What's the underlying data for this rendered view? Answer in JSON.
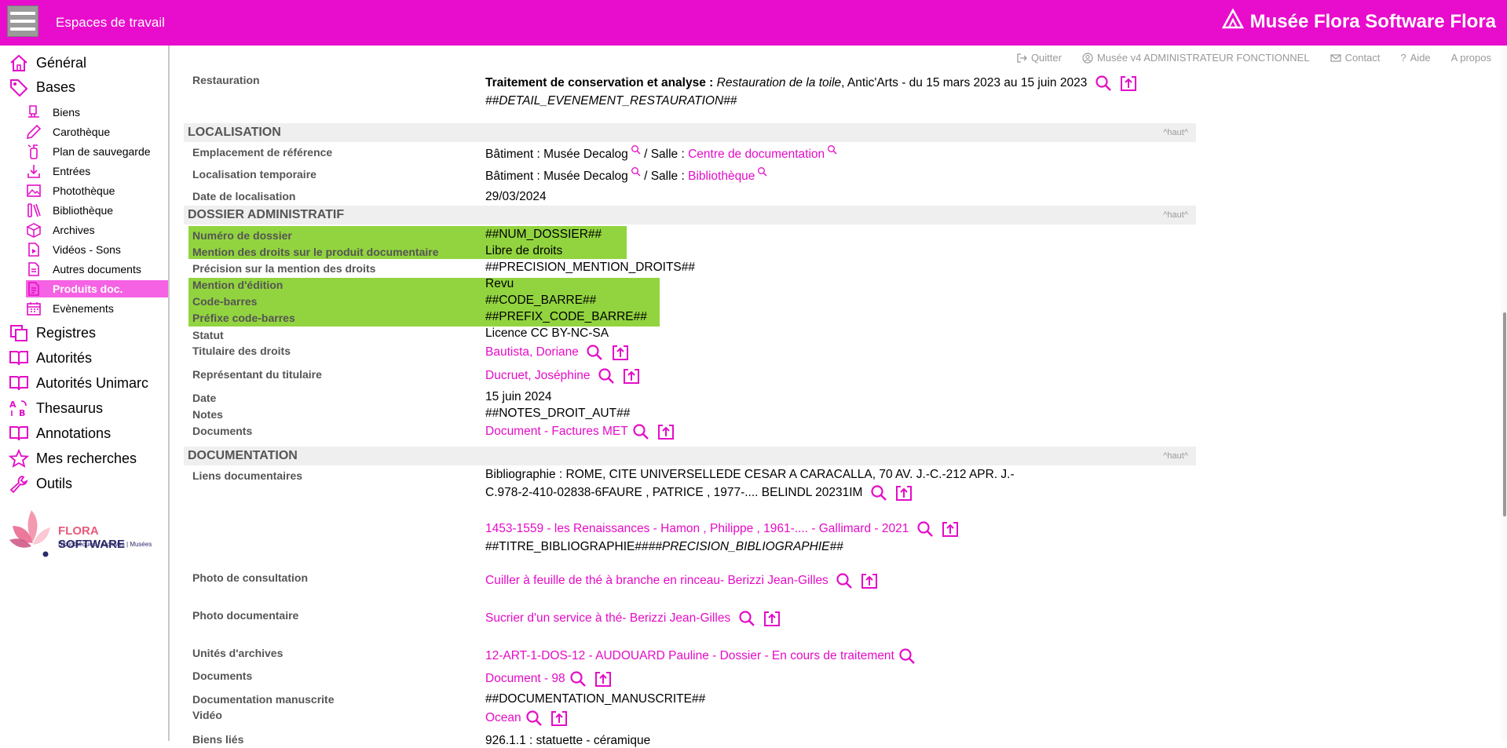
{
  "header": {
    "workspaces_label": "Espaces de travail",
    "brand": "Musée Flora Software Flora",
    "accent_color": "#e80ccc"
  },
  "utilbar": {
    "quit": "Quitter",
    "user": "Musée v4 ADMINISTRATEUR FONCTIONNEL",
    "contact": "Contact",
    "help": "Aide",
    "about": "A propos"
  },
  "sidebar": {
    "general": "Général",
    "bases": "Bases",
    "sub": [
      "Biens",
      "Carothèque",
      "Plan de sauvegarde",
      "Entrées",
      "Photothèque",
      "Bibliothèque",
      "Archives",
      "Vidéos - Sons",
      "Autres documents",
      "Produits doc.",
      "Evènements"
    ],
    "bottom": [
      "Registres",
      "Autorités",
      "Autorités Unimarc",
      "Thesaurus",
      "Annotations",
      "Mes recherches",
      "Outils"
    ],
    "logo_name_1": "FLORA",
    "logo_name_2": "SOFTWARE",
    "logo_tagline": "Bibliothèques | Archives | Musées"
  },
  "top_link": "^haut^",
  "restauration": {
    "label": "Restauration",
    "bold": "Traitement de conservation et analyse :",
    "italic": "Restauration de la toile",
    "rest": ",  Antic'Arts - du 15 mars 2023 au 15 juin 2023",
    "detail": "##DETAIL_EVENEMENT_RESTAURATION##"
  },
  "localisation": {
    "title": "LOCALISATION",
    "ref_label": "Emplacement de référence",
    "ref_building": "Bâtiment : Musée Decalog",
    "ref_sep": " /  Salle : ",
    "ref_room": "Centre de documentation",
    "temp_label": "Localisation temporaire",
    "temp_building": "Bâtiment : Musée Decalog",
    "temp_sep": " /  Salle : ",
    "temp_room": "Bibliothèque",
    "date_label": "Date de localisation",
    "date_value": "29/03/2024"
  },
  "dossier": {
    "title": "DOSSIER ADMINISTRATIF",
    "rows": [
      {
        "label": "Numéro de dossier",
        "value": "##NUM_DOSSIER##"
      },
      {
        "label": "Mention des droits sur le produit documentaire",
        "value": "Libre de droits"
      },
      {
        "label": "Précision sur la mention des droits",
        "value": "##PRECISION_MENTION_DROITS##"
      },
      {
        "label": "Mention d'édition",
        "value": "Revu"
      },
      {
        "label": "Code-barres",
        "value": "##CODE_BARRE##"
      },
      {
        "label": "Préfixe code-barres",
        "value": "##PREFIX_CODE_BARRE##"
      },
      {
        "label": "Statut",
        "value": "Licence CC BY-NC-SA"
      },
      {
        "label": "Titulaire des droits",
        "value": "Bautista, Doriane"
      },
      {
        "label": "Représentant du titulaire",
        "value": "Ducruet, Joséphine"
      },
      {
        "label": "Date",
        "value": "15 juin 2024"
      },
      {
        "label": "Notes",
        "value": "##NOTES_DROIT_AUT##"
      },
      {
        "label": "Documents",
        "value": "Document - Factures MET"
      }
    ],
    "highlight_color": "#92d43f"
  },
  "documentation": {
    "title": "DOCUMENTATION",
    "liens_label": "Liens documentaires",
    "liens_line1": "Bibliographie : ROME, CITE UNIVERSELLEDE CESAR A CARACALLA, 70 AV. J.-C.-212 APR. J.-",
    "liens_line2": "C.978-2-410-02838-6FAURE , PATRICE , 1977-.... BELINDL 20231IM",
    "liens_link": "1453-1559 - les Renaissances - Hamon , Philippe , 1961-.... - Gallimard - 2021",
    "liens_titre": "##TITRE_BIBLIOGRAPHIE##",
    "liens_precision": "##PRECISION_BIBLIOGRAPHIE##",
    "photo_consult_label": "Photo de consultation",
    "photo_consult_value": "Cuiller à feuille de thé à branche en rinceau- Berizzi Jean-Gilles",
    "photo_doc_label": "Photo documentaire",
    "photo_doc_value": "Sucrier d'un service à thé- Berizzi Jean-Gilles",
    "archives_label": "Unités d'archives",
    "archives_value": "12-ART-1-DOS-12 - AUDOUARD Pauline - Dossier - En cours de traitement",
    "documents_label": "Documents",
    "documents_value": "Document - 98",
    "manuscrite_label": "Documentation manuscrite",
    "manuscrite_value": "##DOCUMENTATION_MANUSCRITE##",
    "video_label": "Vidéo",
    "video_value": "Ocean",
    "biens_label": "Biens liés",
    "biens_value": "926.1.1 : statuette - céramique"
  }
}
